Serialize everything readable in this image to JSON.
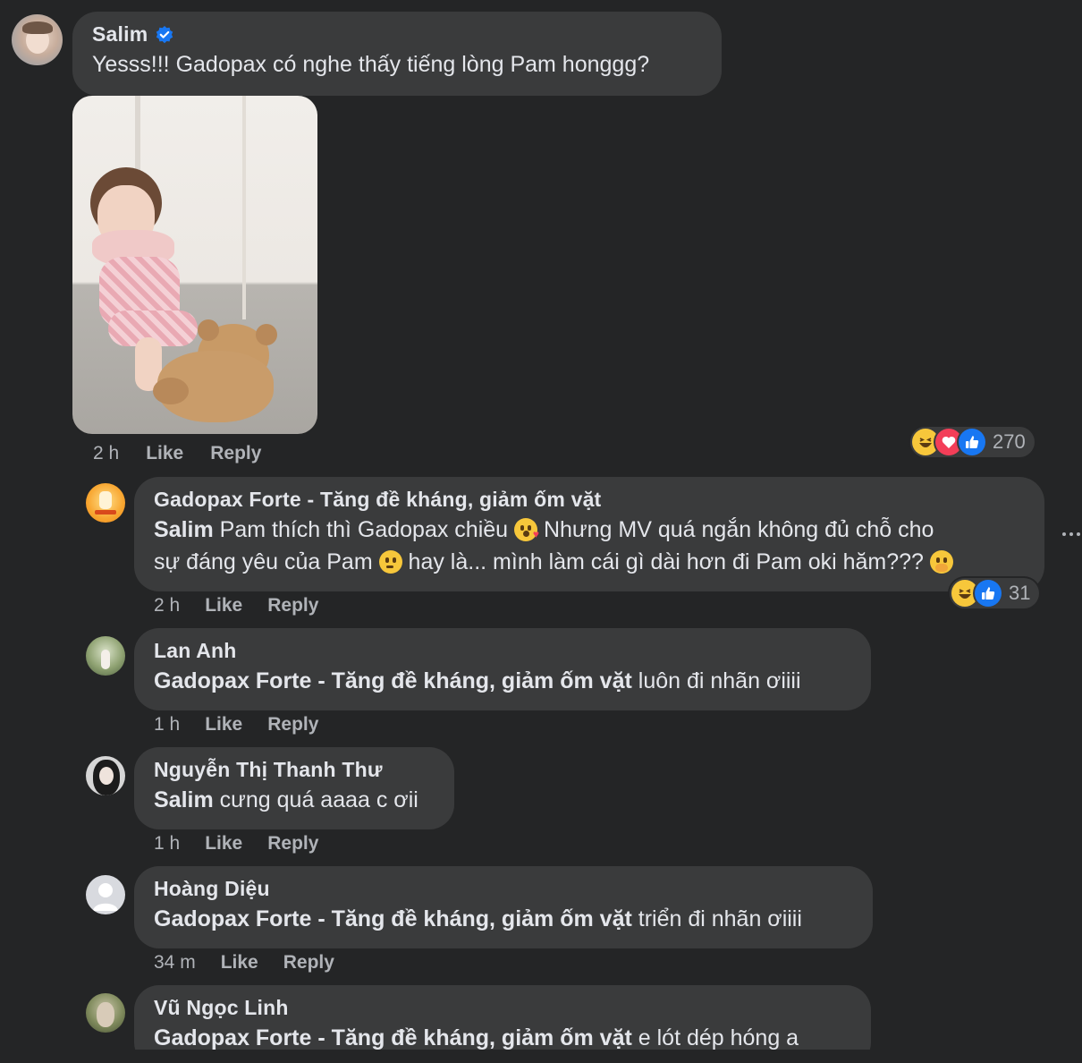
{
  "comment": {
    "author": "Salim",
    "verified_icon": "verified-badge-icon",
    "text": "Yesss!!! Gadopax có nghe thấy tiếng lòng Pam honggg?",
    "time": "2 h",
    "like_label": "Like",
    "reply_label": "Reply",
    "reactions": {
      "icons": [
        "haha",
        "love",
        "like"
      ],
      "count": "270"
    }
  },
  "replies": [
    {
      "author": "Gadopax Forte - Tăng đề kháng, giảm ốm vặt",
      "line1_mention": "Salim",
      "line1": " Pam thích thì Gadopax chiều ",
      "line1_emoji": "kissing-face",
      "line1_cont": " Nhưng MV quá ngắn không đủ chỗ cho",
      "line2": "sự đáng yêu của Pam ",
      "line2_emoji": "thinking-face",
      "line2_cont": " hay là... mình làm cái gì dài hơn đi Pam oki hăm??? ",
      "line2_emoji2": "hand-over-mouth-face",
      "time": "2 h",
      "like_label": "Like",
      "reply_label": "Reply",
      "reactions": {
        "icons": [
          "haha",
          "like"
        ],
        "count": "31"
      }
    },
    {
      "author": "Lan Anh",
      "mention": "Gadopax Forte - Tăng đề kháng, giảm ốm vặt",
      "text": " luôn đi nhãn ơiiii",
      "time": "1 h",
      "like_label": "Like",
      "reply_label": "Reply"
    },
    {
      "author": "Nguyễn Thị Thanh Thư",
      "mention": "Salim",
      "text": " cưng quá aaaa c ơii",
      "time": "1 h",
      "like_label": "Like",
      "reply_label": "Reply"
    },
    {
      "author": "Hoàng Diệu",
      "mention": "Gadopax Forte - Tăng đề kháng, giảm ốm vặt",
      "text": " triển đi nhãn ơiiii",
      "time": "34 m",
      "like_label": "Like",
      "reply_label": "Reply"
    },
    {
      "author": "Vũ Ngọc Linh",
      "mention": "Gadopax Forte - Tăng đề kháng, giảm ốm vặt",
      "text": " e lót dép hóng a",
      "time": "",
      "like_label": "",
      "reply_label": ""
    }
  ],
  "more_icon": "more-options-icon",
  "colors": {
    "background": "#242526",
    "bubble": "#3a3b3c",
    "text": "#e4e6eb",
    "secondary": "#b0b3b8",
    "like_blue": "#1877f2",
    "love_red": "#f33e58",
    "haha_yellow": "#f7c73b"
  }
}
